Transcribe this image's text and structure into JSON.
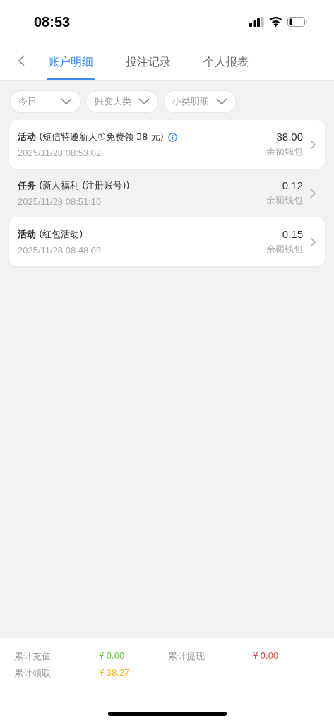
{
  "status_bar": {
    "time": "08:53"
  },
  "tabs": [
    {
      "label": "账户明细",
      "selected": true
    },
    {
      "label": "投注记录",
      "selected": false
    },
    {
      "label": "个人报表",
      "selected": false
    }
  ],
  "filters": [
    {
      "label": "今日"
    },
    {
      "label": "账变大类"
    },
    {
      "label": "小类明细"
    }
  ],
  "records": [
    {
      "title": "**活动** (短信特邀新人①免费领 38 元)",
      "info": true,
      "time": "2025/11/28 08:53:02",
      "amount": "38.00",
      "wallet": "余额钱包",
      "card": true
    },
    {
      "title": "**任务** (新人福利 (注册账号))",
      "info": false,
      "time": "2025/11/28 08:51:10",
      "amount": "0.12",
      "wallet": "余额钱包",
      "card": false
    },
    {
      "title": "**活动** (红包活动)",
      "info": false,
      "time": "2025/11/28 08:48:09",
      "amount": "0.15",
      "wallet": "余额钱包",
      "card": true
    }
  ],
  "summary": [
    {
      "label": "累计充值",
      "value": "¥ 0.00",
      "color": "#6cbf4a"
    },
    {
      "label": "累计提现",
      "value": "¥ 0.00",
      "color": "#d94040"
    },
    {
      "label": "累计领取",
      "value": "¥ 38.27",
      "color": "#f5b820"
    }
  ]
}
